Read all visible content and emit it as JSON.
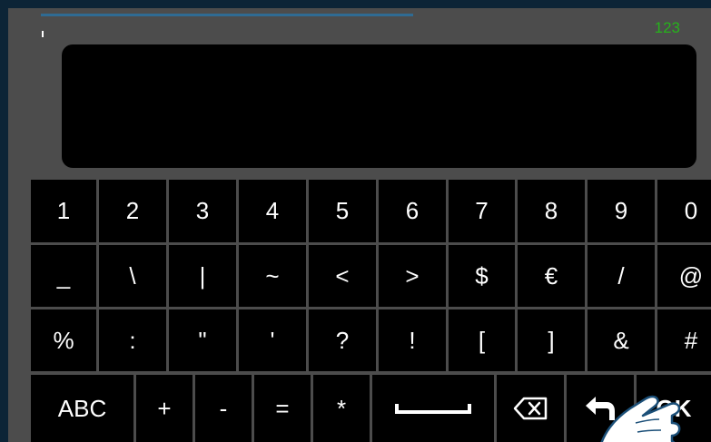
{
  "mode_indicator": "123",
  "input_text": "",
  "keyboard": {
    "row1": [
      "1",
      "2",
      "3",
      "4",
      "5",
      "6",
      "7",
      "8",
      "9",
      "0"
    ],
    "row2": [
      "_",
      "\\",
      "|",
      "~",
      "<",
      ">",
      "$",
      "€",
      "/",
      "@"
    ],
    "row3": [
      "%",
      ":",
      "\"",
      "'",
      "?",
      "!",
      "[",
      "]",
      "&",
      "#"
    ],
    "row4": {
      "abc": "ABC",
      "plus": "+",
      "minus": "-",
      "equals": "=",
      "asterisk": "*",
      "space_icon": "space-bar-icon",
      "backspace_icon": "backspace-icon",
      "return_icon": "return-arrow-icon",
      "ok": "OK"
    }
  },
  "colors": {
    "frame": "#0c2436",
    "background": "#4c4c4c",
    "key": "#000000",
    "accent_blue": "#2f6b93",
    "mode_green": "#26b21b"
  }
}
